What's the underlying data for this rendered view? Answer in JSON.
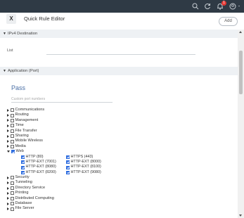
{
  "topbar": {
    "icons": [
      "search-icon",
      "refresh-icon",
      "bell-icon",
      "user-icon"
    ],
    "notification_count": "1"
  },
  "header": {
    "close_label": "X",
    "title": "Quick Rule Editor",
    "add_label": "Add"
  },
  "ipv4": {
    "section_label": "IPv4 Destination",
    "list_label": "List",
    "list_value": ""
  },
  "app": {
    "section_label": "Application (Port)",
    "pass_title": "Pass",
    "custom_placeholder": "Custom port numbers",
    "categories": [
      {
        "label": "Communications",
        "checked": false,
        "expanded": false
      },
      {
        "label": "Routing",
        "checked": false,
        "expanded": false
      },
      {
        "label": "Management",
        "checked": false,
        "expanded": false
      },
      {
        "label": "Time",
        "checked": false,
        "expanded": false
      },
      {
        "label": "File Transfer",
        "checked": false,
        "expanded": false
      },
      {
        "label": "Sharing",
        "checked": false,
        "expanded": false
      },
      {
        "label": "Mobile Wireless",
        "checked": false,
        "expanded": false
      },
      {
        "label": "Media",
        "checked": false,
        "expanded": false
      },
      {
        "label": "Web",
        "checked": true,
        "expanded": true
      },
      {
        "label": "Security",
        "checked": false,
        "expanded": false
      },
      {
        "label": "Tunneling",
        "checked": false,
        "expanded": false
      },
      {
        "label": "Directory Service",
        "checked": false,
        "expanded": false
      },
      {
        "label": "Printing",
        "checked": false,
        "expanded": false
      },
      {
        "label": "Distributed Computing",
        "checked": false,
        "expanded": false
      },
      {
        "label": "Database",
        "checked": false,
        "expanded": false
      },
      {
        "label": "File Server",
        "checked": false,
        "expanded": false
      }
    ],
    "web_ports": [
      [
        "HTTP (80)",
        "HTTPS (443)"
      ],
      [
        "HTTP-EXT (7001)",
        "HTTP-EXT (8000)"
      ],
      [
        "HTTP-EXT (8080)",
        "HTTP-EXT (8100)"
      ],
      [
        "HTTP-EXT (8200)",
        "HTTP-EXT (9080)"
      ]
    ]
  }
}
